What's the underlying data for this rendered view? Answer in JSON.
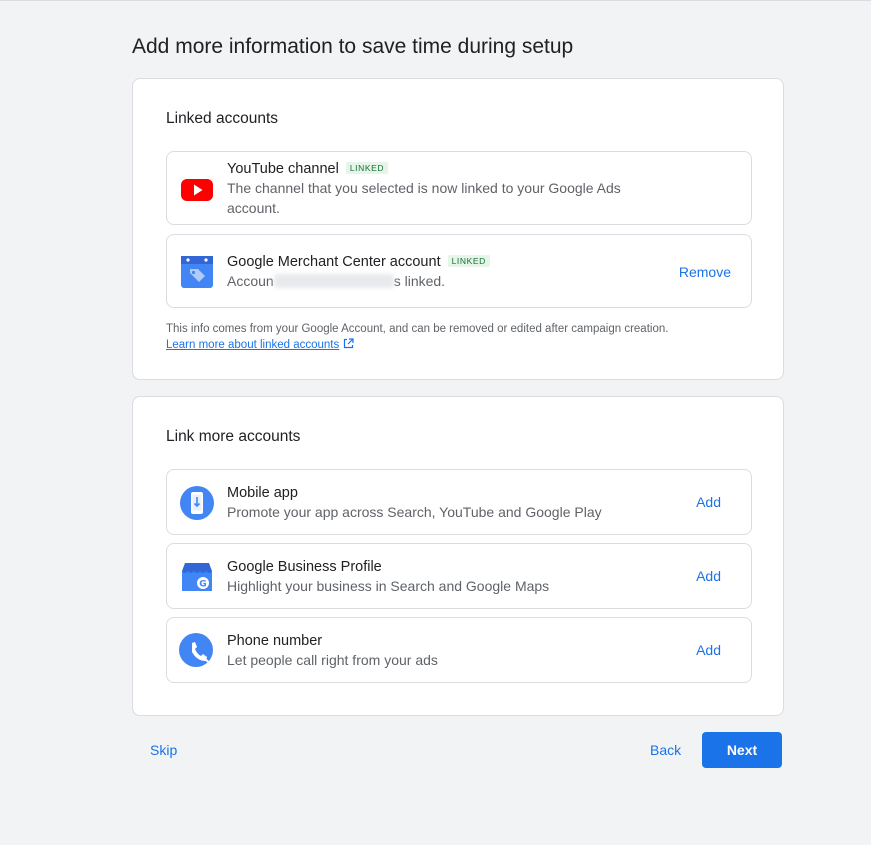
{
  "page": {
    "title": "Add more information to save time during setup"
  },
  "linked_accounts": {
    "heading": "Linked accounts",
    "items": [
      {
        "title": "YouTube channel",
        "badge": "LINKED",
        "description": "The channel that you selected is now linked to your Google Ads account.",
        "icon": "youtube-icon"
      },
      {
        "title": "Google Merchant Center account",
        "badge": "LINKED",
        "description_start": "Accoun",
        "description_end": "s linked.",
        "action": "Remove",
        "icon": "merchant-center-icon"
      }
    ],
    "info_text": "This info comes from your Google Account, and can be removed or edited after campaign creation.",
    "info_link": "Learn more about linked accounts"
  },
  "link_more": {
    "heading": "Link more accounts",
    "items": [
      {
        "title": "Mobile app",
        "description": "Promote your app across Search, YouTube and Google Play",
        "action": "Add",
        "icon": "mobile-app-icon"
      },
      {
        "title": "Google Business Profile",
        "description": "Highlight your business in Search and Google Maps",
        "action": "Add",
        "icon": "business-profile-icon"
      },
      {
        "title": "Phone number",
        "description": "Let people call right from your ads",
        "action": "Add",
        "icon": "phone-icon"
      }
    ]
  },
  "footer": {
    "skip": "Skip",
    "back": "Back",
    "next": "Next"
  },
  "colors": {
    "accent": "#1a73e8",
    "linked_badge_text": "#137333",
    "linked_badge_bg": "#e6f4ea",
    "youtube_red": "#ff0000",
    "background": "#f1f3f4"
  }
}
